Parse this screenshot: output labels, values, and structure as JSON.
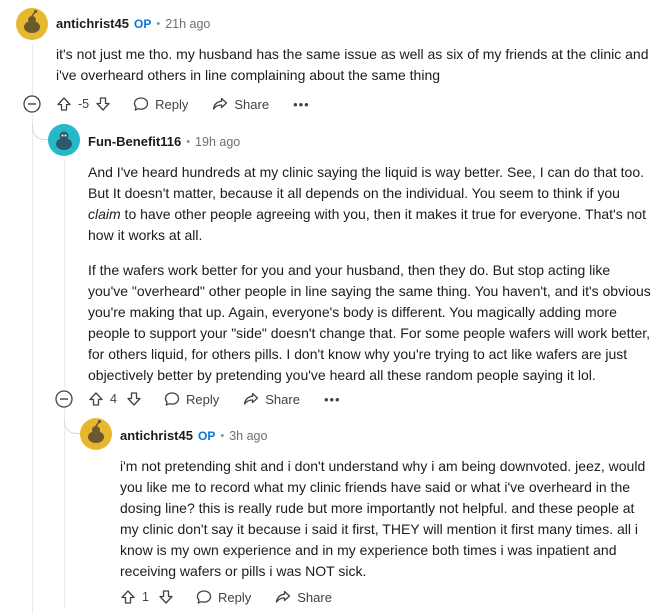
{
  "comments": [
    {
      "author": "antichrist45",
      "op_badge": "OP",
      "time": "21h ago",
      "paragraphs": [
        "it's not just me tho. my husband has the same issue as well as six of my friends at the clinic and i've overheard others in line complaining about the same thing"
      ],
      "score": "-5",
      "reply_label": "Reply",
      "share_label": "Share",
      "avatar_color": "#e8b730"
    },
    {
      "author": "Fun-Benefit116",
      "time": "19h ago",
      "paragraphs": [
        {
          "before": "And I've heard hundreds at my clinic saying the liquid is way better. See, I can do that too. But It doesn't matter, because it all depends on the individual. You seem to think if you ",
          "em": "claim",
          "after": " to have other people agreeing with you, then it makes it true for everyone. That's not how it works at all."
        },
        "If the wafers work better for you and your husband, then they do. But stop acting like you've \"overheard\" other people in line saying the same thing. You haven't, and it's obvious you're making that up. Again, everyone's body is different. You magically adding more people to support your \"side\" doesn't change that. For some people wafers will work better, for others liquid, for others pills. I don't know why you're trying to act like wafers are just objectively better by pretending you've heard all these random people saying it lol."
      ],
      "score": "4",
      "reply_label": "Reply",
      "share_label": "Share",
      "avatar_color": "#24b8c9"
    },
    {
      "author": "antichrist45",
      "op_badge": "OP",
      "time": "3h ago",
      "paragraphs": [
        "i'm not pretending shit and i don't understand why i am being downvoted. jeez, would you like me to record what my clinic friends have said or what i've overheard in the dosing line? this is really rude but more importantly not helpful. and these people at my clinic don't say it because i said it first, THEY will mention it first many times. all i know is my own experience and in my experience both times i was inpatient and receiving wafers or pills i was NOT sick."
      ],
      "score": "1",
      "reply_label": "Reply",
      "share_label": "Share",
      "avatar_color": "#e8b730"
    }
  ],
  "icons": {
    "upvote": "arrow-up-icon",
    "downvote": "arrow-down-icon",
    "reply": "speech-bubble-icon",
    "share": "share-arrow-icon",
    "more": "ellipsis-icon",
    "collapse": "collapse-minus-icon"
  }
}
